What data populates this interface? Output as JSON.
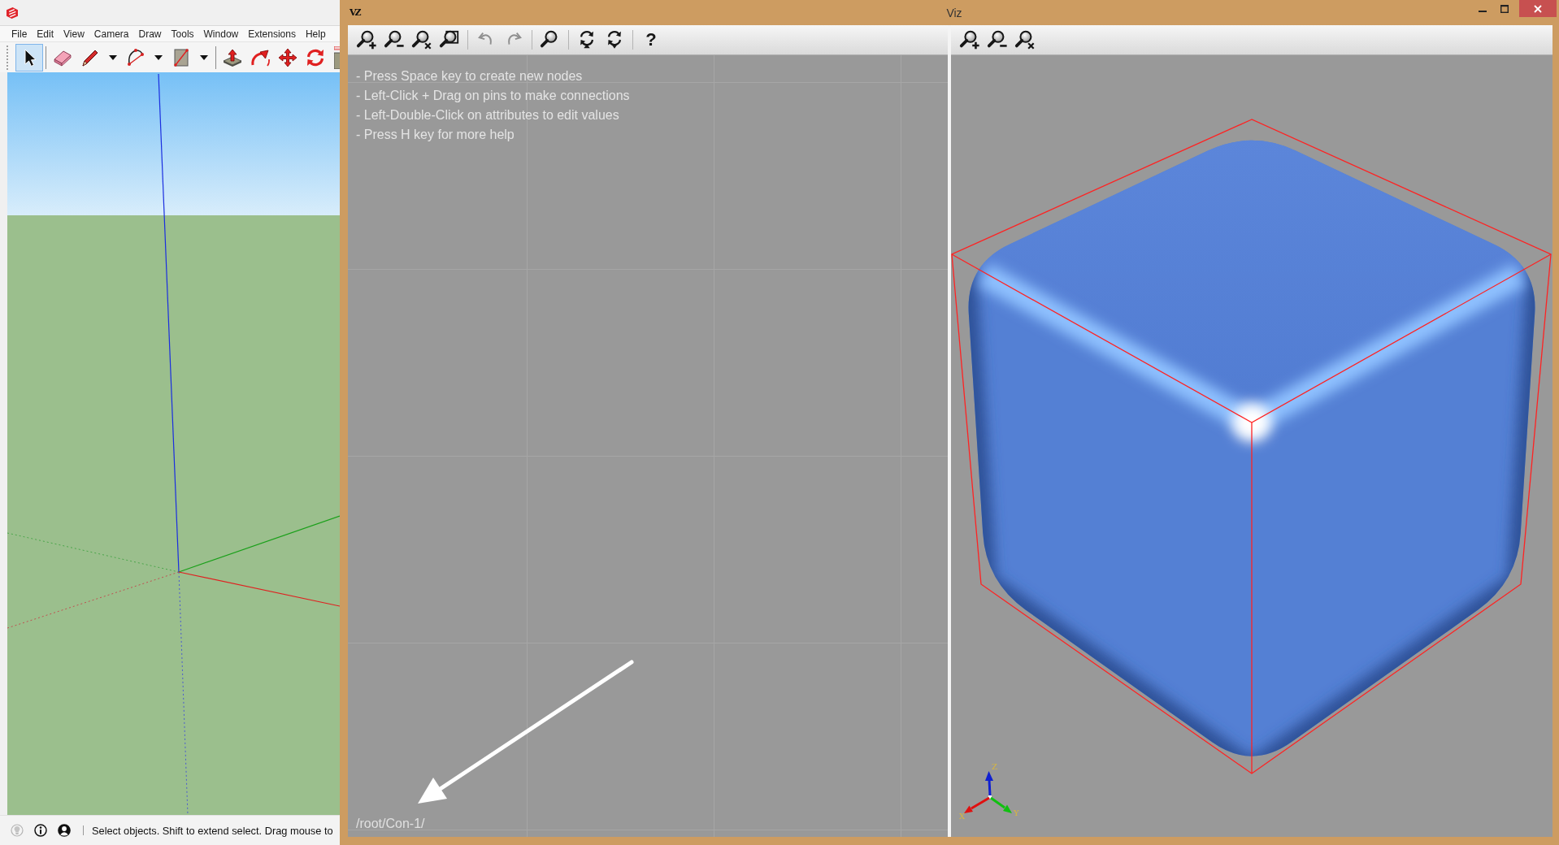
{
  "sketchup_window": {
    "menu": [
      "File",
      "Edit",
      "View",
      "Camera",
      "Draw",
      "Tools",
      "Window",
      "Extensions",
      "Help"
    ],
    "toolbar": [
      {
        "selected": true,
        "dropdown": false
      },
      {
        "selected": false,
        "dropdown": false
      },
      {
        "selected": false,
        "dropdown": true
      },
      {
        "selected": false,
        "dropdown": true
      },
      {
        "selected": false,
        "dropdown": true
      },
      {
        "selected": false,
        "dropdown": false
      },
      {
        "selected": false,
        "dropdown": false
      },
      {
        "selected": false,
        "dropdown": false
      },
      {
        "selected": false,
        "dropdown": false
      }
    ],
    "status_text": "Select objects. Shift to extend select. Drag mouse to"
  },
  "viz_window": {
    "logo": "VZ",
    "title": "Viz",
    "node_toolbar": [
      {
        "disabled": false
      },
      {
        "disabled": false
      },
      {
        "disabled": false
      },
      {
        "disabled": false
      },
      {
        "disabled": true
      },
      {
        "disabled": true
      },
      {
        "disabled": false
      },
      {
        "disabled": false
      },
      {
        "disabled": false
      }
    ],
    "help_button": "?",
    "help_lines": [
      "- Press Space key to create new nodes",
      "- Left-Click + Drag on pins to make connections",
      "- Left-Double-Click on attributes to edit values",
      "- Press H key for more help"
    ],
    "path": "/root/Con-1/",
    "axis_labels": [
      "X",
      "Y",
      "Z"
    ]
  }
}
